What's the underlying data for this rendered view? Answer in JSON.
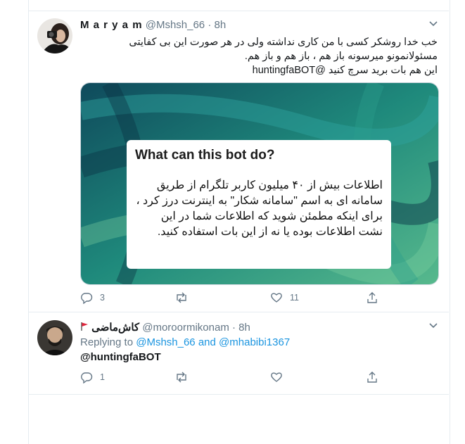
{
  "tweet1": {
    "display_name": "M a r y a m",
    "handle": "@Mshsh_66",
    "dot": "·",
    "time": "8h",
    "lines": [
      "خب خدا روشکر کسی با من کاری نداشته ولی در هر صورت این بی کفایتی",
      "مسئولانمونو میرسونه باز هم ، باز هم و باز هم.",
      "این هم بات برید سرچ کنید @huntingfaBOT"
    ],
    "card": {
      "title": "What can this bot do?",
      "text": "اطلاعات بیش از ۴۰ میلیون کاربر تلگرام از طریق سامانه ای  به اسم \"سامانه شکار\" به اینترنت درز کرد ، برای اینکه مطمئن شوید که اطلاعات شما در این نشت اطلاعات بوده یا نه از این بات استفاده کنید."
    },
    "actions": {
      "reply_count": "3",
      "retweet_count": "",
      "like_count": "11"
    }
  },
  "tweet2": {
    "display_name": "کاش‌ماضی",
    "flag_icon": "red-flag-icon",
    "handle": "@moroormikonam",
    "dot": "·",
    "time": "8h",
    "replying_prefix": "Replying to",
    "replying_user1": "@Mshsh_66",
    "replying_and": "and",
    "replying_user2": "@mhabibi1367",
    "text": "@huntingfaBOT",
    "actions": {
      "reply_count": "1",
      "retweet_count": "",
      "like_count": ""
    }
  },
  "colors": {
    "icon_grey": "#657786",
    "link_blue": "#1b95e0",
    "divider": "#e6ecf0"
  }
}
